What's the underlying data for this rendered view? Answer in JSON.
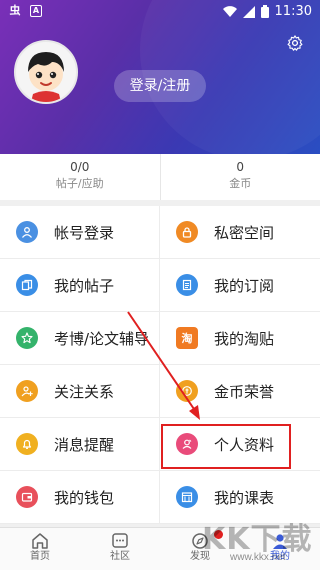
{
  "statusbar": {
    "time": "11:30"
  },
  "header": {
    "login_label": "登录/注册"
  },
  "stats": [
    {
      "value": "0/0",
      "label": "帖子/应助"
    },
    {
      "value": "0",
      "label": "金币"
    }
  ],
  "menu": [
    {
      "label": "帐号登录",
      "icon": "user-icon",
      "color": "#4a90e2"
    },
    {
      "label": "私密空间",
      "icon": "lock-icon",
      "color": "#f08a24"
    },
    {
      "label": "我的帖子",
      "icon": "copy-icon",
      "color": "#3a8ee6"
    },
    {
      "label": "我的订阅",
      "icon": "document-icon",
      "color": "#3a8ee6"
    },
    {
      "label": "考博/论文辅导",
      "icon": "star-icon",
      "color": "#34b36b"
    },
    {
      "label": "我的淘贴",
      "icon": "tao-icon",
      "color": "#f07a22"
    },
    {
      "label": "关注关系",
      "icon": "add-user-icon",
      "color": "#f0a020"
    },
    {
      "label": "金币荣誉",
      "icon": "coin-icon",
      "color": "#f0a020"
    },
    {
      "label": "消息提醒",
      "icon": "bell-icon",
      "color": "#f0b020"
    },
    {
      "label": "个人资料",
      "icon": "profile-icon",
      "color": "#e94b7a"
    },
    {
      "label": "我的钱包",
      "icon": "wallet-icon",
      "color": "#e8505b"
    },
    {
      "label": "我的课表",
      "icon": "schedule-icon",
      "color": "#3a8ee6"
    }
  ],
  "tabs": [
    {
      "label": "首页",
      "icon": "home-icon"
    },
    {
      "label": "社区",
      "icon": "community-icon"
    },
    {
      "label": "发现",
      "icon": "compass-icon"
    },
    {
      "label": "我的",
      "icon": "me-icon"
    }
  ],
  "colors": {
    "accent": "#3b5bd6",
    "highlight": "#e02020"
  },
  "watermark": {
    "big": "KK下载",
    "small": "www.kkx.net"
  }
}
